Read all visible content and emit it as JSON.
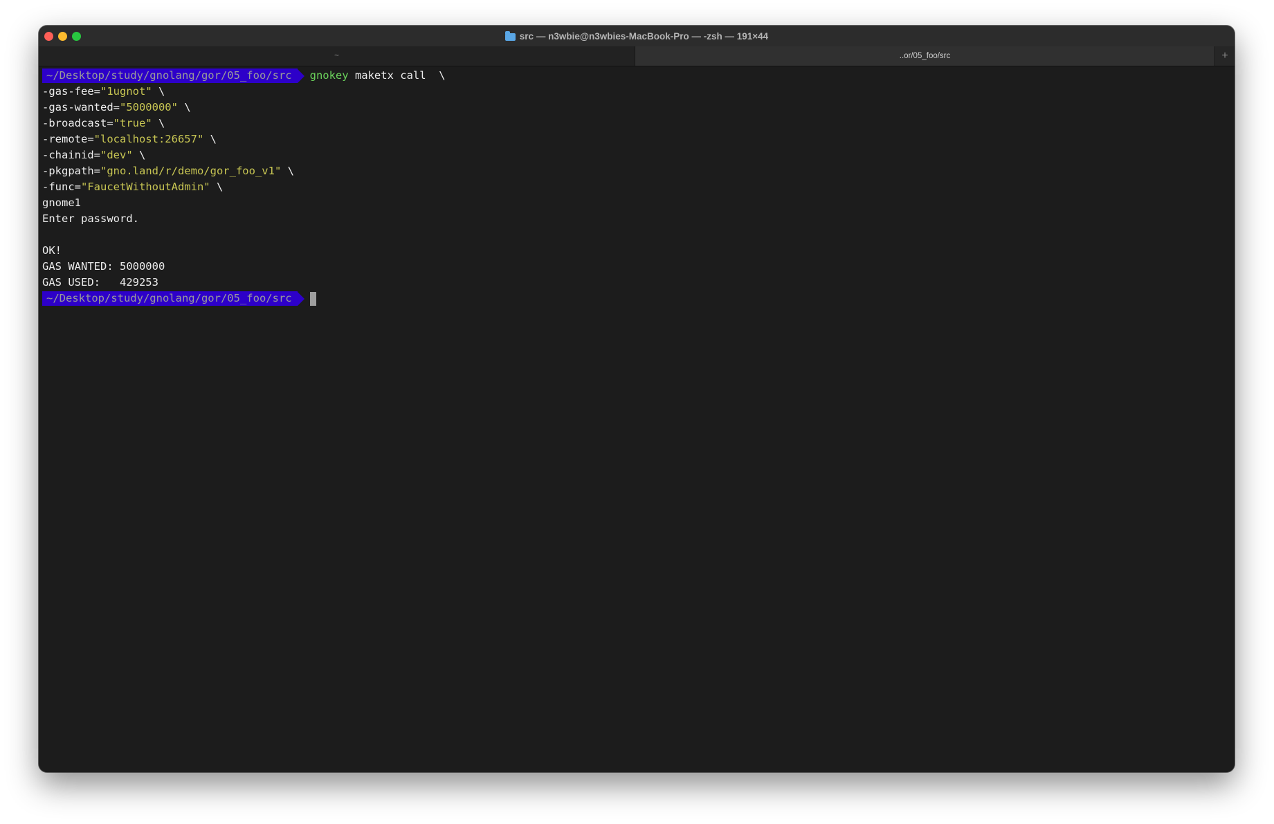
{
  "window": {
    "title": "src — n3wbie@n3wbies-MacBook-Pro — -zsh — 191×44",
    "icon": "folder-icon"
  },
  "tabs": [
    {
      "label": "~"
    },
    {
      "label": "..or/05_foo/src"
    }
  ],
  "tab_add_label": "+",
  "terminal": {
    "prompt": "~/Desktop/study/gnolang/gor/05_foo/src",
    "command": {
      "program": "gnokey",
      "args": " maketx call  \\"
    },
    "flags": [
      {
        "key": "-gas-fee=",
        "value": "\"1ugnot\"",
        "tail": " \\"
      },
      {
        "key": "-gas-wanted=",
        "value": "\"5000000\"",
        "tail": " \\"
      },
      {
        "key": "-broadcast=",
        "value": "\"true\"",
        "tail": " \\"
      },
      {
        "key": "-remote=",
        "value": "\"localhost:26657\"",
        "tail": " \\"
      },
      {
        "key": "-chainid=",
        "value": "\"dev\"",
        "tail": " \\"
      },
      {
        "key": "-pkgpath=",
        "value": "\"gno.land/r/demo/gor_foo_v1\"",
        "tail": " \\"
      },
      {
        "key": "-func=",
        "value": "\"FaucetWithoutAdmin\"",
        "tail": " \\"
      }
    ],
    "output": {
      "key_name": "gnome1",
      "password_prompt": "Enter password.",
      "blank": "",
      "ok": "OK!",
      "gas_wanted": "GAS WANTED: 5000000",
      "gas_used": "GAS USED:   429253"
    }
  },
  "colors": {
    "prompt_bg": "#2d00c9",
    "command_green": "#6bd25b",
    "string_yellow": "#c8c653",
    "terminal_bg": "#1c1c1c"
  }
}
